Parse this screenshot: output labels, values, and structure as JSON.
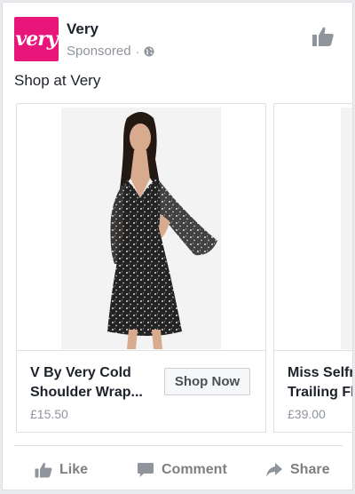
{
  "header": {
    "logo_text": "very",
    "page_name": "Very",
    "sponsored": "Sponsored",
    "separator": "·",
    "logo_color": "#e8157b"
  },
  "post_text": "Shop at Very",
  "carousel": {
    "cards": [
      {
        "title_line1": "V By Very Cold",
        "title_line2": "Shoulder Wrap...",
        "price": "£15.50",
        "button_label": "Shop Now",
        "image": "black-floral-dress-model"
      },
      {
        "title_line1": "Miss Selfri",
        "title_line2": "Trailing Flo",
        "price": "£39.00",
        "image": "product-image"
      }
    ]
  },
  "actions": {
    "like_label": "Like",
    "comment_label": "Comment",
    "share_label": "Share"
  },
  "icons": {
    "globe": "globe-icon",
    "like_page": "thumbs-up-icon",
    "like": "thumbs-up-icon",
    "comment": "speech-bubble-icon",
    "share": "share-arrow-icon"
  }
}
